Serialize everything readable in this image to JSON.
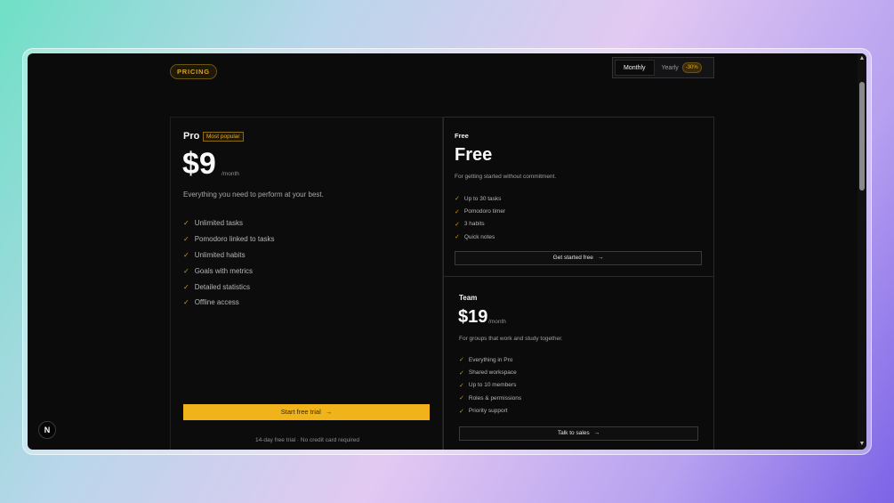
{
  "header": {
    "badge": "PRICING",
    "billing_toggle": {
      "monthly": "Monthly",
      "yearly": "Yearly",
      "discount": "-30%"
    }
  },
  "plans": {
    "pro": {
      "name": "Pro",
      "tag": "Most popular",
      "price": "$9",
      "period": "/month",
      "description": "Everything you need to perform at your best.",
      "features": [
        "Unlimited tasks",
        "Pomodoro linked to tasks",
        "Unlimited habits",
        "Goals with metrics",
        "Detailed statistics",
        "Offline access"
      ],
      "cta": "Start free trial",
      "note": "14-day free trial · No credit card required"
    },
    "free": {
      "name": "Free",
      "price": "Free",
      "description": "For getting started without commitment.",
      "features": [
        "Up to 30 tasks",
        "Pomodoro timer",
        "3 habits",
        "Quick notes"
      ],
      "cta": "Get started free"
    },
    "team": {
      "name": "Team",
      "price": "$19",
      "period": "/month",
      "description": "For groups that work and study together.",
      "features": [
        "Everything in Pro",
        "Shared workspace",
        "Up to 10 members",
        "Roles & permissions",
        "Priority support"
      ],
      "cta": "Talk to sales"
    }
  },
  "icons": {
    "check": "check-icon",
    "arrow": "arrow-right-icon",
    "logo": "N"
  },
  "colors": {
    "accent": "#f0b41a",
    "background": "#0b0b0c"
  }
}
